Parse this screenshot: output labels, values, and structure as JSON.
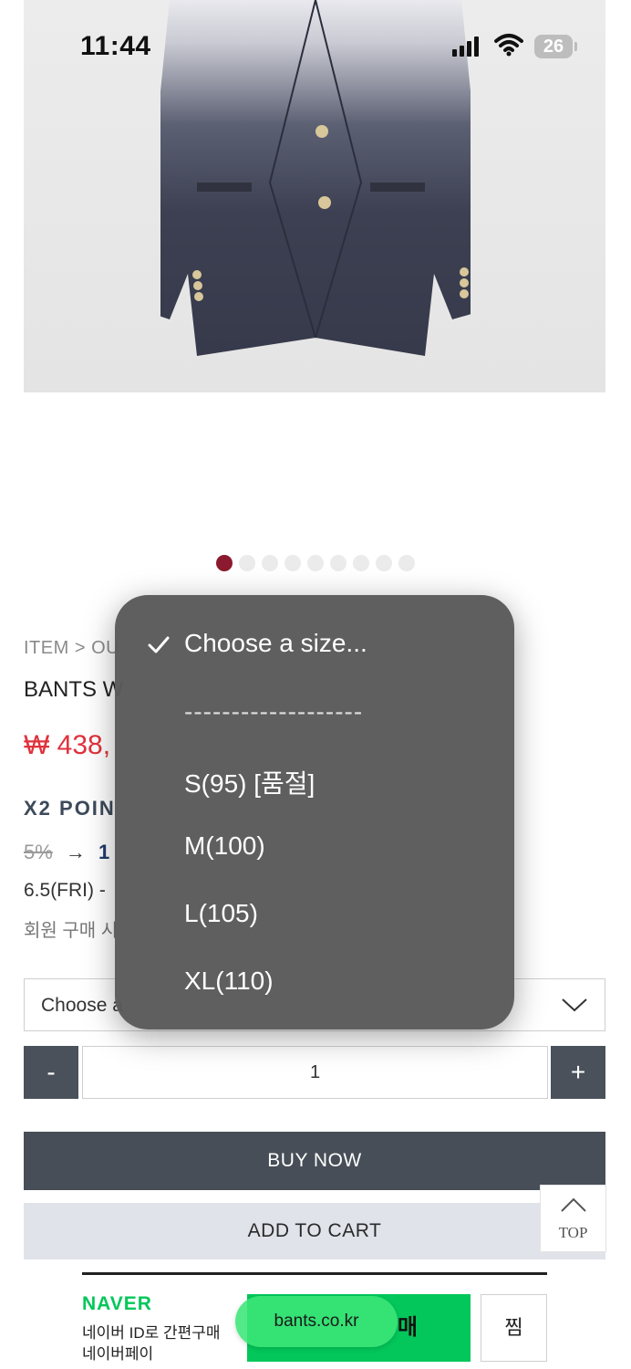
{
  "status_bar": {
    "time": "11:44",
    "battery": "26"
  },
  "carousel": {
    "total": 9,
    "active_index": 0,
    "active_color": "#8b1a2f"
  },
  "product": {
    "breadcrumb": "ITEM > OU",
    "name": "BANTS W",
    "price": "₩ 438,",
    "point_title": "X2 POIN",
    "point_old": "5%",
    "point_arrow": "→",
    "point_new": "1",
    "shipping": "6.5(FRI) -",
    "member_note": "회원 구매 시"
  },
  "size_select": {
    "value": "Choose a"
  },
  "quantity": {
    "minus": "-",
    "value": "1",
    "plus": "+"
  },
  "actions": {
    "buy_now": "BUY NOW",
    "add_to_cart": "ADD TO CART",
    "top": "TOP"
  },
  "naver": {
    "logo": "NAVER",
    "line1": "네이버 ID로 간편구매",
    "line2": "네이버페이",
    "pay_label": "매",
    "zzim": "찜",
    "domain": "bants.co.kr"
  },
  "dropdown": {
    "options": [
      {
        "label": "Choose a size...",
        "selected": true
      },
      {
        "label": "-------------------",
        "selected": false
      },
      {
        "label": "S(95) [품절]",
        "selected": false
      },
      {
        "label": "M(100)",
        "selected": false
      },
      {
        "label": "L(105)",
        "selected": false
      },
      {
        "label": "XL(110)",
        "selected": false
      }
    ]
  },
  "colors": {
    "accent_red": "#e0323c",
    "naver_green": "#03c75a",
    "dark_button": "#474e57"
  }
}
